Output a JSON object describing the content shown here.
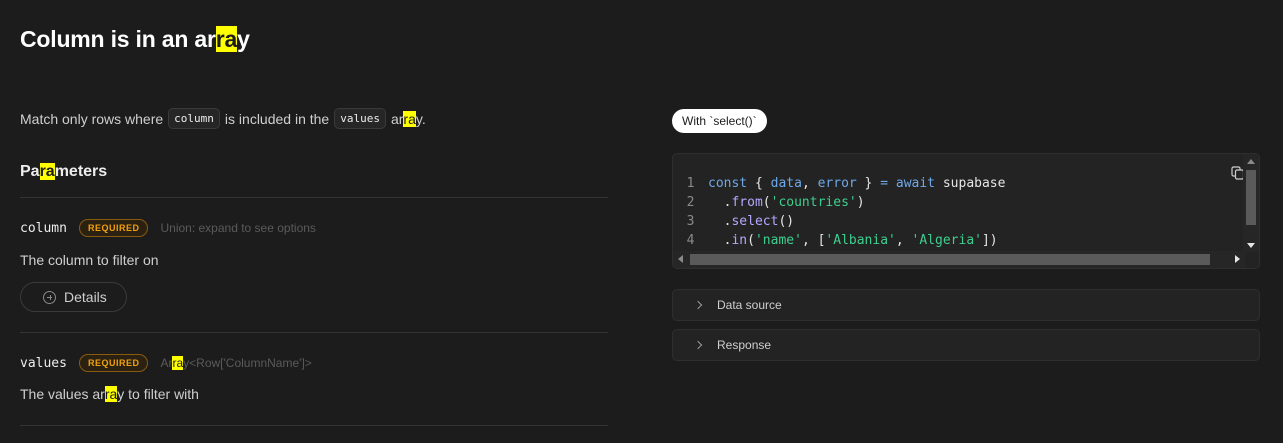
{
  "page": {
    "title_parts": [
      "Column is in an ar",
      "ra",
      "y"
    ]
  },
  "description": {
    "part1": "Match only rows where",
    "pill1": "column",
    "part2": "is included in the",
    "pill2": "values",
    "part3_a": "ar",
    "part3_hl": "ra",
    "part3_b": "y."
  },
  "parameters": {
    "heading_parts": [
      "Pa",
      "ra",
      "meters"
    ],
    "items": [
      {
        "name": "column",
        "badge": "REQUIRED",
        "type": "Union: expand to see options",
        "description": "The column to filter on",
        "details_label": "Details"
      },
      {
        "name": "values",
        "badge": "REQUIRED",
        "type_parts": [
          "Ar",
          "ra",
          "y<Row['ColumnName']>"
        ],
        "description_parts": [
          "The values ar",
          "ra",
          "y to filter with"
        ]
      }
    ]
  },
  "example": {
    "tab_label": "With `select()`",
    "code_lines": [
      {
        "n": "1",
        "tokens": [
          [
            "kw",
            "const"
          ],
          [
            "plain",
            " { "
          ],
          [
            "var",
            "data"
          ],
          [
            "plain",
            ", "
          ],
          [
            "var",
            "error"
          ],
          [
            "plain",
            " } "
          ],
          [
            "op",
            "="
          ],
          [
            "plain",
            " "
          ],
          [
            "kw",
            "await"
          ],
          [
            "plain",
            " supabase"
          ]
        ]
      },
      {
        "n": "2",
        "tokens": [
          [
            "plain",
            "  ."
          ],
          [
            "fn",
            "from"
          ],
          [
            "plain",
            "("
          ],
          [
            "str",
            "'countries'"
          ],
          [
            "plain",
            ")"
          ]
        ]
      },
      {
        "n": "3",
        "tokens": [
          [
            "plain",
            "  ."
          ],
          [
            "fn",
            "select"
          ],
          [
            "plain",
            "()"
          ]
        ]
      },
      {
        "n": "4",
        "tokens": [
          [
            "plain",
            "  ."
          ],
          [
            "fn",
            "in"
          ],
          [
            "plain",
            "("
          ],
          [
            "str",
            "'name'"
          ],
          [
            "plain",
            ", ["
          ],
          [
            "str",
            "'Albania'"
          ],
          [
            "plain",
            ", "
          ],
          [
            "str",
            "'Algeria'"
          ],
          [
            "plain",
            "])"
          ]
        ]
      }
    ],
    "accordions": [
      "Data source",
      "Response"
    ]
  },
  "colors": {
    "background": "#1c1c1c",
    "highlight": "#ffff00",
    "badge": "#f1a10d",
    "string": "#3ecf8e"
  }
}
